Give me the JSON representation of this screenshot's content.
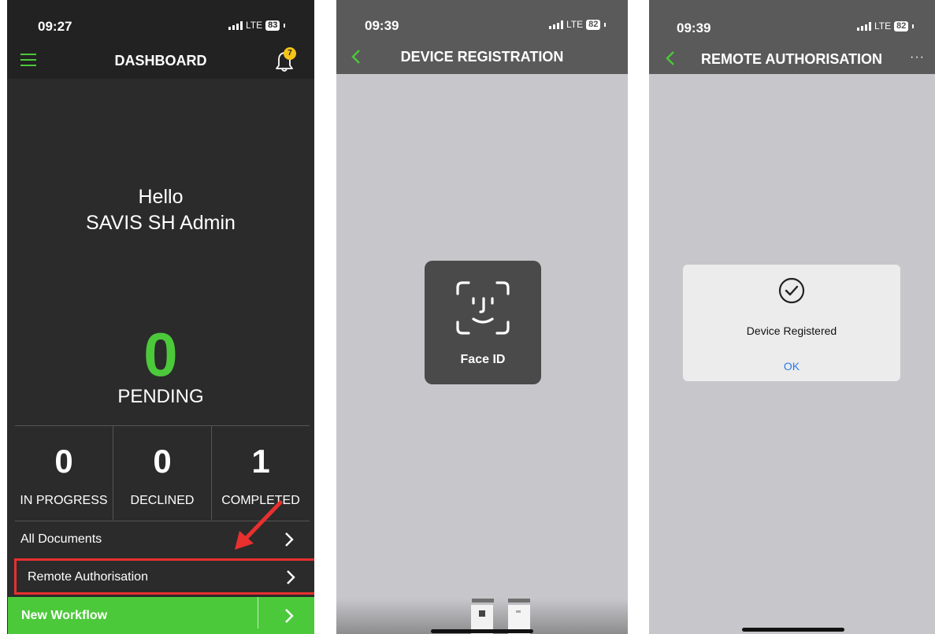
{
  "screen1": {
    "status": {
      "time": "09:27",
      "network": "LTE",
      "battery": "83"
    },
    "header": {
      "title": "DASHBOARD",
      "notifications": "7"
    },
    "greeting": {
      "line1": "Hello",
      "line2": "SAVIS SH Admin"
    },
    "pending": {
      "count": "0",
      "label": "PENDING"
    },
    "stats": [
      {
        "count": "0",
        "label": "IN PROGRESS"
      },
      {
        "count": "0",
        "label": "DECLINED"
      },
      {
        "count": "1",
        "label": "COMPLETED"
      }
    ],
    "menu": {
      "all_documents": "All Documents",
      "remote_authorisation": "Remote Authorisation",
      "new_workflow": "New Workflow"
    },
    "colors": {
      "accent": "#4cc93a",
      "highlight": "#e8302f",
      "background": "#2b2b2b"
    }
  },
  "screen2": {
    "status": {
      "time": "09:39",
      "network": "LTE",
      "battery": "82"
    },
    "title": "DEVICE REGISTRATION",
    "face_id_label": "Face ID"
  },
  "screen3": {
    "status": {
      "time": "09:39",
      "network": "LTE",
      "battery": "82"
    },
    "title": "REMOTE AUTHORISATION",
    "more": "···",
    "alert": {
      "message": "Device Registered",
      "button": "OK"
    }
  }
}
